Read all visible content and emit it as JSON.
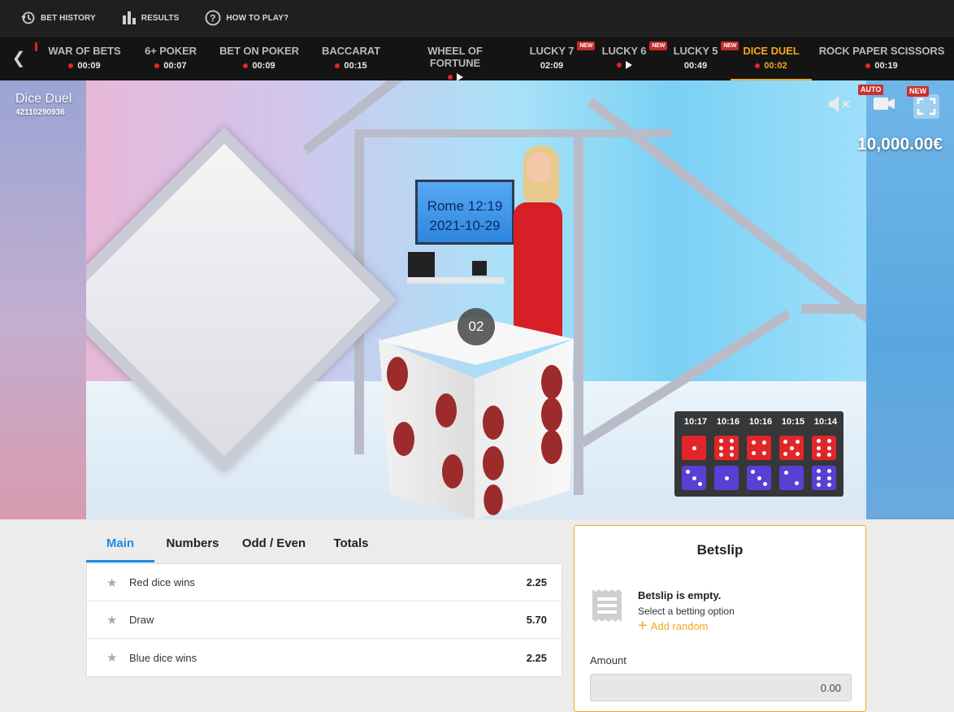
{
  "topnav": {
    "bet_history": "BET HISTORY",
    "results": "RESULTS",
    "how_to_play": "HOW TO PLAY?"
  },
  "game_tabs": [
    {
      "name": "WAR OF BETS",
      "time": "00:09",
      "live": true,
      "play": false,
      "new": false,
      "active": false
    },
    {
      "name": "6+ POKER",
      "time": "00:07",
      "live": true,
      "play": false,
      "new": false,
      "active": false
    },
    {
      "name": "BET ON POKER",
      "time": "00:09",
      "live": true,
      "play": false,
      "new": false,
      "active": false
    },
    {
      "name": "BACCARAT",
      "time": "00:15",
      "live": true,
      "play": false,
      "new": false,
      "active": false
    },
    {
      "name": "WHEEL OF FORTUNE",
      "time": "",
      "live": true,
      "play": true,
      "new": false,
      "active": false
    },
    {
      "name": "LUCKY 7",
      "time": "02:09",
      "live": false,
      "play": false,
      "new": true,
      "active": false
    },
    {
      "name": "LUCKY 6",
      "time": "",
      "live": true,
      "play": true,
      "new": true,
      "active": false
    },
    {
      "name": "LUCKY 5",
      "time": "00:49",
      "live": false,
      "play": false,
      "new": true,
      "active": false
    },
    {
      "name": "DICE DUEL",
      "time": "00:02",
      "live": true,
      "play": false,
      "new": false,
      "active": true
    },
    {
      "name": "ROCK PAPER SCISSORS",
      "time": "00:19",
      "live": true,
      "play": false,
      "new": false,
      "active": false
    }
  ],
  "new_badge": "NEW",
  "video": {
    "game_title": "Dice Duel",
    "game_id": "42110290936",
    "screen_line1": "Rome 12:19",
    "screen_line2": "2021-10-29",
    "countdown": "02",
    "auto_badge": "AUTO",
    "new_badge": "NEW",
    "balance": "10,000.00€"
  },
  "history": {
    "times": [
      "10:17",
      "10:16",
      "10:16",
      "10:15",
      "10:14"
    ],
    "red": [
      1,
      6,
      4,
      5,
      6
    ],
    "blue": [
      3,
      1,
      3,
      2,
      6
    ],
    "colors": {
      "red": "#e12629",
      "blue": "#5a3fd4"
    }
  },
  "market_tabs": [
    "Main",
    "Numbers",
    "Odd / Even",
    "Totals"
  ],
  "markets": [
    {
      "label": "Red dice wins",
      "odds": "2.25"
    },
    {
      "label": "Draw",
      "odds": "5.70"
    },
    {
      "label": "Blue dice wins",
      "odds": "2.25"
    }
  ],
  "betslip": {
    "title": "Betslip",
    "empty": "Betslip is empty.",
    "sub": "Select a betting option",
    "random": "Add random",
    "amount_label": "Amount",
    "amount_value": "0.00"
  },
  "colors": {
    "accent": "#f2a820",
    "tab_active": "#1f8be0",
    "live": "#e0262b"
  }
}
